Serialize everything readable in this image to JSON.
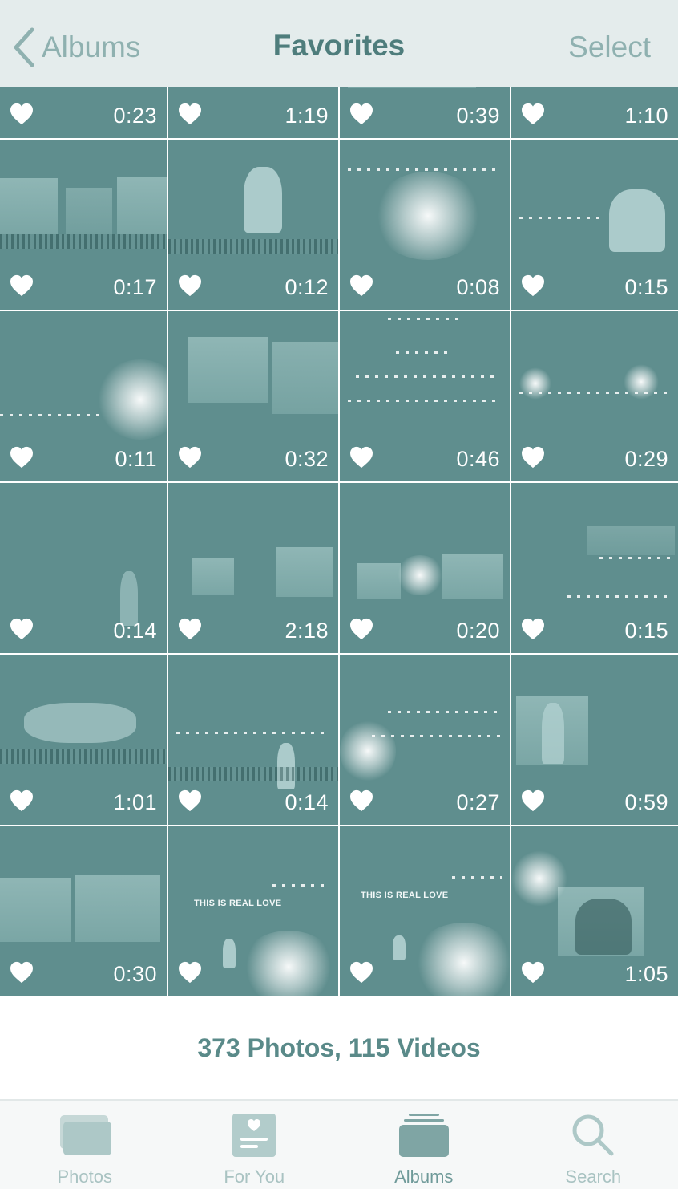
{
  "nav": {
    "back_label": "Albums",
    "title": "Favorites",
    "select_label": "Select"
  },
  "grid": {
    "rows": [
      [
        "0:23",
        "1:19",
        "0:39",
        "1:10"
      ],
      [
        "0:17",
        "0:12",
        "0:08",
        "0:15"
      ],
      [
        "0:11",
        "0:32",
        "0:46",
        "0:29"
      ],
      [
        "0:14",
        "2:18",
        "0:20",
        "0:15"
      ],
      [
        "1:01",
        "0:14",
        "0:27",
        "0:59"
      ],
      [
        "0:30",
        "",
        "",
        "1:05"
      ]
    ],
    "overlay_texts": {
      "r5c1": "THIS IS REAL LOVE",
      "r5c2": "THIS IS REAL LOVE"
    }
  },
  "summary": {
    "counts": "373 Photos, 115 Videos"
  },
  "tabbar": {
    "tabs": [
      {
        "label": "Photos",
        "icon": "photos-icon",
        "active": false
      },
      {
        "label": "For You",
        "icon": "for-you-icon",
        "active": false
      },
      {
        "label": "Albums",
        "icon": "albums-icon",
        "active": true
      },
      {
        "label": "Search",
        "icon": "search-icon",
        "active": false
      }
    ]
  },
  "colors": {
    "tint": "#5f8e8e",
    "nav_bg": "#e4ecec",
    "accent": "#8fb1b0",
    "title": "#4e7d7c"
  }
}
